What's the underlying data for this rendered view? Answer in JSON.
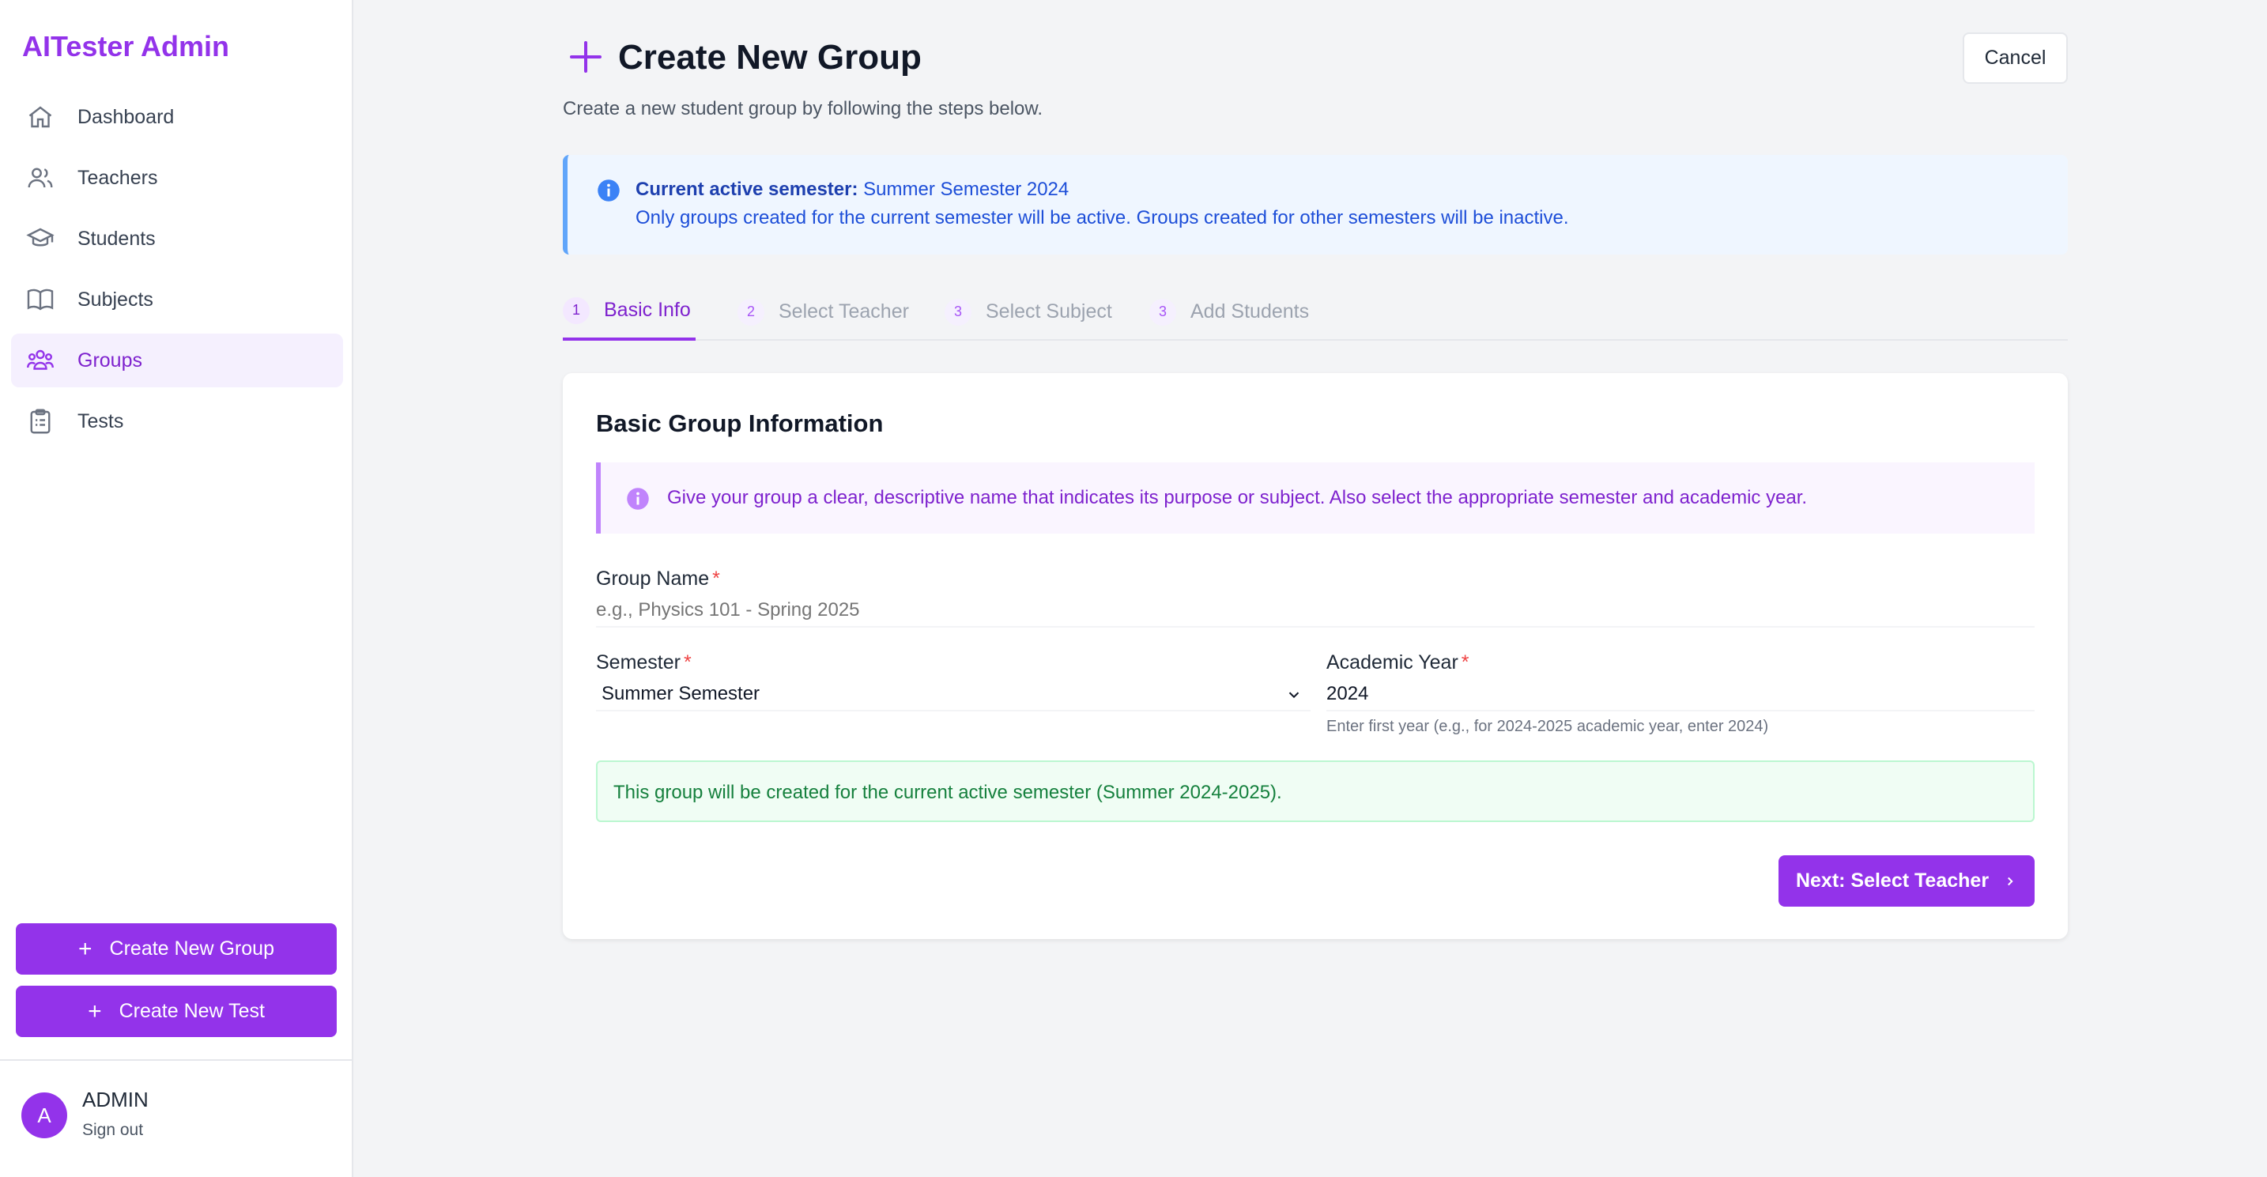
{
  "app": {
    "brand": "AITester Admin"
  },
  "sidebar": {
    "items": [
      {
        "label": "Dashboard",
        "icon": "home-icon",
        "active": false
      },
      {
        "label": "Teachers",
        "icon": "users-icon",
        "active": false
      },
      {
        "label": "Students",
        "icon": "graduation-cap-icon",
        "active": false
      },
      {
        "label": "Subjects",
        "icon": "book-icon",
        "active": false
      },
      {
        "label": "Groups",
        "icon": "group-icon",
        "active": true
      },
      {
        "label": "Tests",
        "icon": "clipboard-icon",
        "active": false
      }
    ],
    "create_group_label": "Create New Group",
    "create_test_label": "Create New Test",
    "user": {
      "initial": "A",
      "name": "ADMIN",
      "signout": "Sign out"
    }
  },
  "header": {
    "title": "Create New Group",
    "subtitle": "Create a new student group by following the steps below.",
    "cancel_label": "Cancel"
  },
  "banner": {
    "label": "Current active semester:",
    "value": "Summer Semester 2024",
    "note": "Only groups created for the current semester will be active. Groups created for other semesters will be inactive."
  },
  "steps": [
    {
      "num": "1",
      "label": "Basic Info",
      "active": true
    },
    {
      "num": "2",
      "label": "Select Teacher",
      "active": false
    },
    {
      "num": "3",
      "label": "Select Subject",
      "active": false
    },
    {
      "num": "3",
      "label": "Add Students",
      "active": false
    }
  ],
  "form": {
    "title": "Basic Group Information",
    "hint": "Give your group a clear, descriptive name that indicates its purpose or subject. Also select the appropriate semester and academic year.",
    "group_name_label": "Group Name",
    "group_name_placeholder": "e.g., Physics 101 - Spring 2025",
    "group_name_value": "",
    "semester_label": "Semester",
    "semester_value": "Summer Semester",
    "year_label": "Academic Year",
    "year_value": "2024",
    "year_help": "Enter first year (e.g., for 2024-2025 academic year, enter 2024)",
    "required_mark": "*",
    "success_note": "This group will be created for the current active semester (Summer 2024-2025).",
    "next_label": "Next: Select Teacher"
  },
  "colors": {
    "accent": "#9333ea",
    "info": "#1d4ed8",
    "success": "#15803d"
  }
}
